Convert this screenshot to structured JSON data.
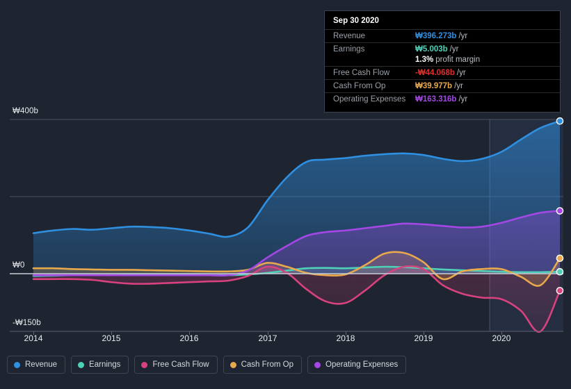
{
  "chart_data": {
    "type": "area",
    "title": "",
    "xlabel": "",
    "ylabel": "",
    "grid": true,
    "legend_position": "bottom",
    "ylim": [
      -150,
      400
    ],
    "yticks": [
      400,
      0,
      -150
    ],
    "ytick_labels": [
      "₩400b",
      "₩0",
      "-₩150b"
    ],
    "xtick_labels": [
      "2014",
      "2015",
      "2016",
      "2017",
      "2018",
      "2019",
      "2020"
    ],
    "x": [
      2014.0,
      2014.25,
      2014.5,
      2014.75,
      2015.0,
      2015.25,
      2015.5,
      2015.75,
      2016.0,
      2016.25,
      2016.5,
      2016.75,
      2017.0,
      2017.25,
      2017.5,
      2017.75,
      2018.0,
      2018.25,
      2018.5,
      2018.75,
      2019.0,
      2019.25,
      2019.5,
      2019.75,
      2020.0,
      2020.25,
      2020.5,
      2020.75
    ],
    "series": [
      {
        "name": "Revenue",
        "color": "#2f8fe0",
        "values": [
          105,
          112,
          116,
          114,
          118,
          122,
          121,
          118,
          112,
          104,
          96,
          120,
          190,
          250,
          290,
          296,
          300,
          306,
          310,
          312,
          308,
          298,
          292,
          298,
          316,
          348,
          378,
          396
        ]
      },
      {
        "name": "Earnings",
        "color": "#4fd1b8",
        "values": [
          -6,
          -5,
          -4,
          -4,
          -4,
          -3,
          -3,
          -3,
          -3,
          -4,
          -4,
          -2,
          2,
          8,
          14,
          15,
          14,
          16,
          18,
          17,
          14,
          11,
          9,
          7,
          5,
          4,
          4,
          5
        ]
      },
      {
        "name": "Free Cash Flow",
        "color": "#d8427e",
        "values": [
          -14,
          -14,
          -14,
          -16,
          -22,
          -26,
          -26,
          -24,
          -22,
          -20,
          -18,
          -6,
          18,
          2,
          -40,
          -72,
          -76,
          -44,
          -4,
          18,
          12,
          -30,
          -52,
          -62,
          -66,
          -96,
          -150,
          -44
        ]
      },
      {
        "name": "Cash From Op",
        "color": "#e8a84c",
        "values": [
          14,
          14,
          12,
          11,
          10,
          10,
          9,
          8,
          7,
          6,
          6,
          10,
          28,
          18,
          2,
          -4,
          -2,
          22,
          52,
          54,
          30,
          -14,
          6,
          12,
          12,
          -8,
          -30,
          40
        ]
      },
      {
        "name": "Operating Expenses",
        "color": "#a347e5",
        "values": [
          -4,
          -4,
          -4,
          -4,
          -4,
          -4,
          -4,
          -4,
          -4,
          -4,
          -4,
          8,
          42,
          72,
          98,
          108,
          112,
          118,
          124,
          130,
          128,
          124,
          120,
          122,
          132,
          146,
          158,
          163
        ]
      }
    ],
    "endpoint_markers": true,
    "forecast_divider_x": 2019.85
  },
  "tooltip": {
    "date": "Sep 30 2020",
    "rows": [
      {
        "label": "Revenue",
        "value": "₩396.273b",
        "unit": "/yr",
        "color": "#2f8fe0"
      },
      {
        "label": "Earnings",
        "value": "₩5.003b",
        "unit": "/yr",
        "color": "#4fd1b8"
      },
      {
        "label": "Free Cash Flow",
        "value": "-₩44.068b",
        "unit": "/yr",
        "color": "#e03030"
      },
      {
        "label": "Cash From Op",
        "value": "₩39.977b",
        "unit": "/yr",
        "color": "#e8a84c"
      },
      {
        "label": "Operating Expenses",
        "value": "₩163.316b",
        "unit": "/yr",
        "color": "#a347e5"
      }
    ],
    "margin_value": "1.3%",
    "margin_text": "profit margin"
  },
  "legend": {
    "items": [
      {
        "label": "Revenue",
        "color": "#2f8fe0"
      },
      {
        "label": "Earnings",
        "color": "#4fd1b8"
      },
      {
        "label": "Free Cash Flow",
        "color": "#d8427e"
      },
      {
        "label": "Cash From Op",
        "color": "#e8a84c"
      },
      {
        "label": "Operating Expenses",
        "color": "#a347e5"
      }
    ]
  },
  "axis": {
    "y": [
      {
        "label": "₩400b",
        "value": 400
      },
      {
        "label": "₩0",
        "value": 0
      },
      {
        "label": "-₩150b",
        "value": -150
      }
    ],
    "x": [
      "2014",
      "2015",
      "2016",
      "2017",
      "2018",
      "2019",
      "2020"
    ]
  }
}
